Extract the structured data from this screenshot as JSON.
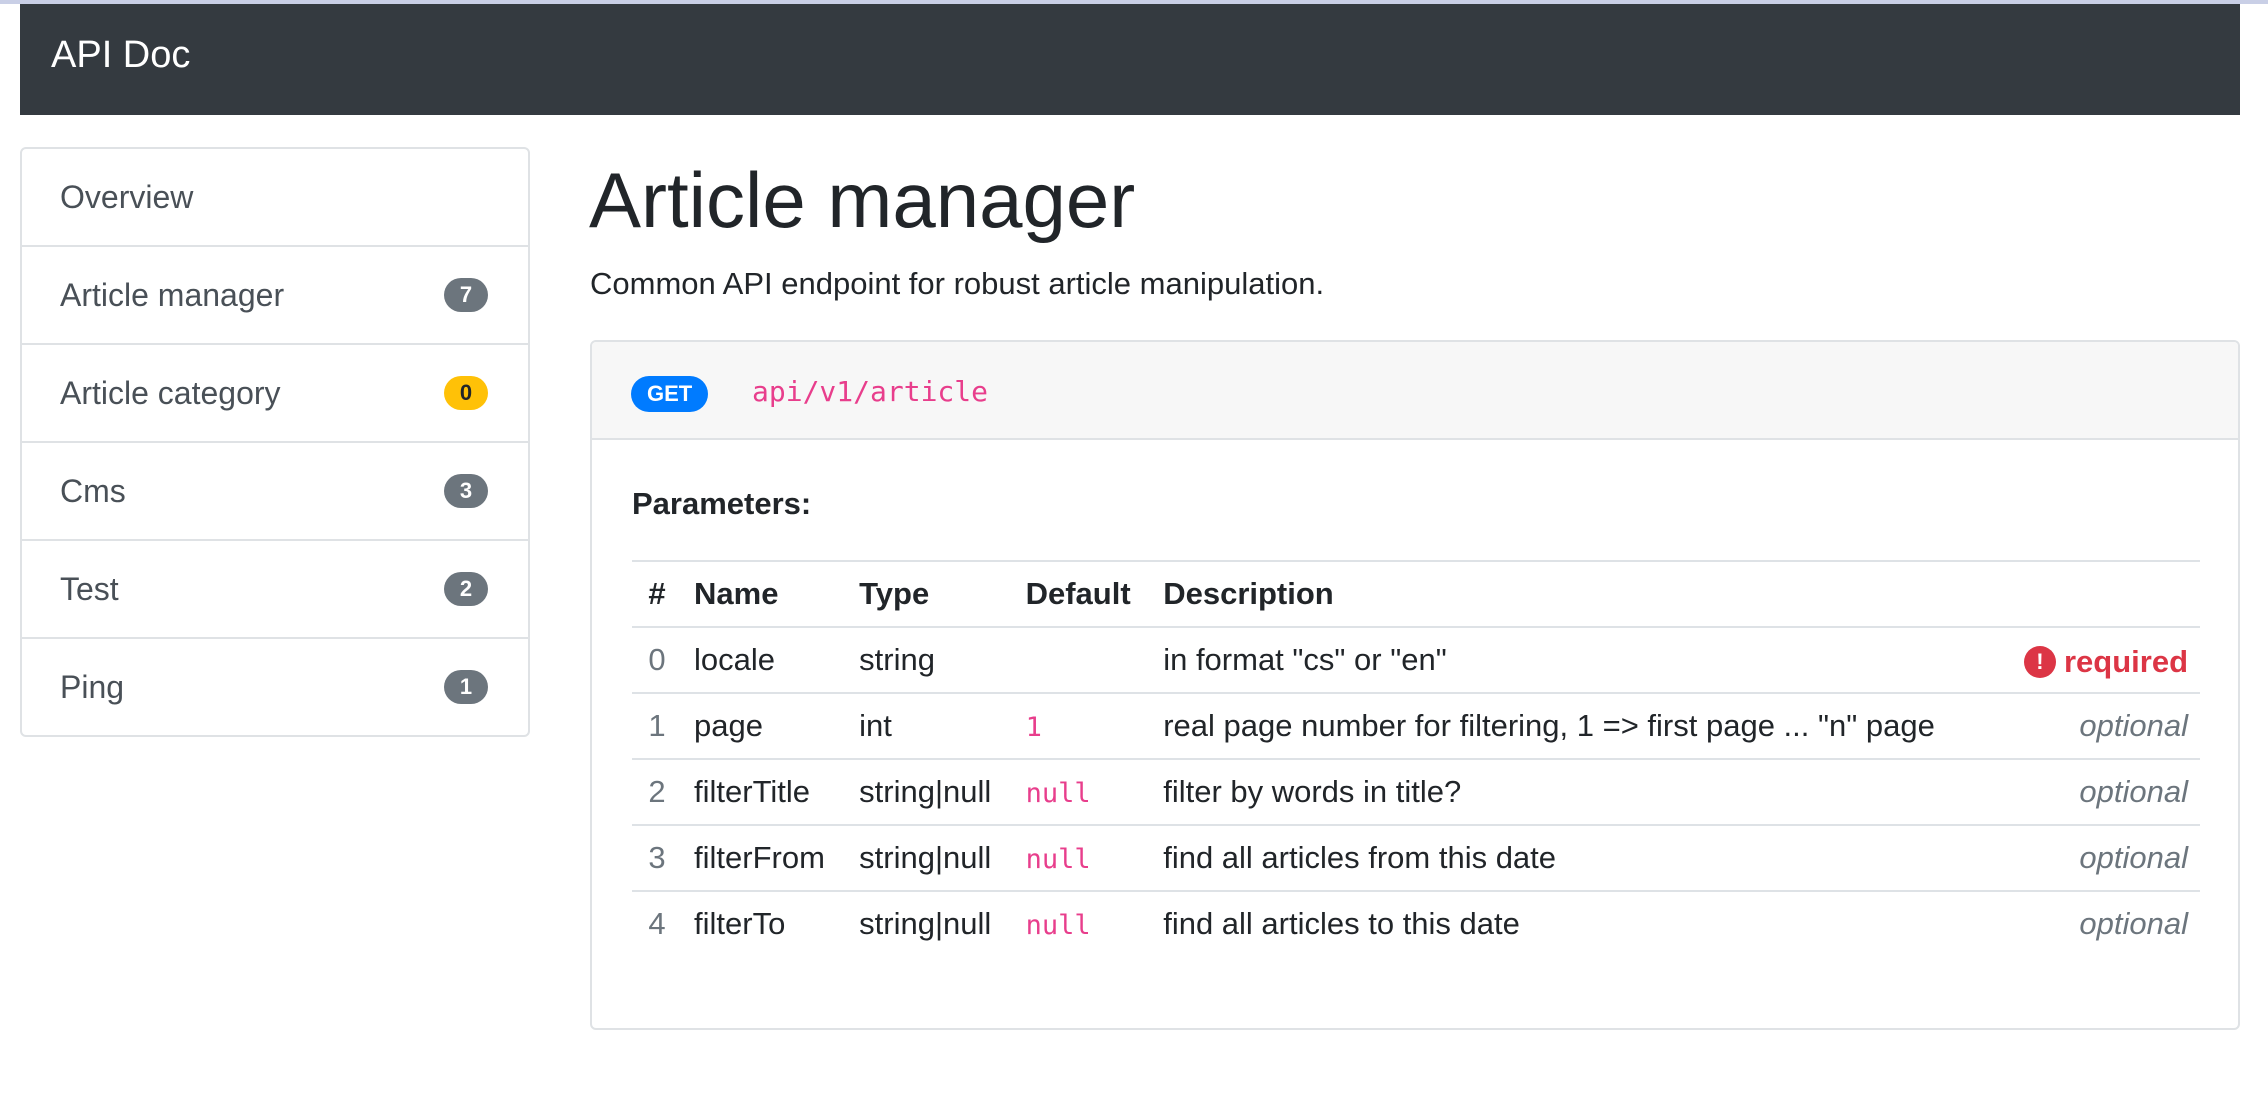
{
  "app": {
    "brand": "API Doc"
  },
  "sidebar": {
    "items": [
      {
        "label": "Overview",
        "badge": null
      },
      {
        "label": "Article manager",
        "badge": "7",
        "badge_color": "#6c757d"
      },
      {
        "label": "Article category",
        "badge": "0",
        "badge_color": "#ffc107"
      },
      {
        "label": "Cms",
        "badge": "3",
        "badge_color": "#6c757d"
      },
      {
        "label": "Test",
        "badge": "2",
        "badge_color": "#6c757d"
      },
      {
        "label": "Ping",
        "badge": "1",
        "badge_color": "#6c757d"
      }
    ]
  },
  "main": {
    "title": "Article manager",
    "description": "Common API endpoint for robust article manipulation.",
    "endpoint": {
      "method": "GET",
      "path": "api/v1/article",
      "method_color": "#007bff"
    },
    "parameters_heading": "Parameters:",
    "table": {
      "headers": [
        "#",
        "Name",
        "Type",
        "Default",
        "Description"
      ],
      "rows": [
        {
          "idx": "0",
          "name": "locale",
          "type": "string",
          "default": "",
          "description": "in format \"cs\" or \"en\"",
          "status": "required"
        },
        {
          "idx": "1",
          "name": "page",
          "type": "int",
          "default": "1",
          "description": "real page number for filtering, 1 => first page ... \"n\" page",
          "status": "optional"
        },
        {
          "idx": "2",
          "name": "filterTitle",
          "type": "string|null",
          "default": "null",
          "description": "filter by words in title?",
          "status": "optional"
        },
        {
          "idx": "3",
          "name": "filterFrom",
          "type": "string|null",
          "default": "null",
          "description": "find all articles from this date",
          "status": "optional"
        },
        {
          "idx": "4",
          "name": "filterTo",
          "type": "string|null",
          "default": "null",
          "description": "find all articles to this date",
          "status": "optional"
        }
      ]
    },
    "status_icon": "exclamation-circle-icon",
    "colors": {
      "required": "#dc3545",
      "code": "#e83e8c",
      "navbar": "#343a40"
    }
  }
}
